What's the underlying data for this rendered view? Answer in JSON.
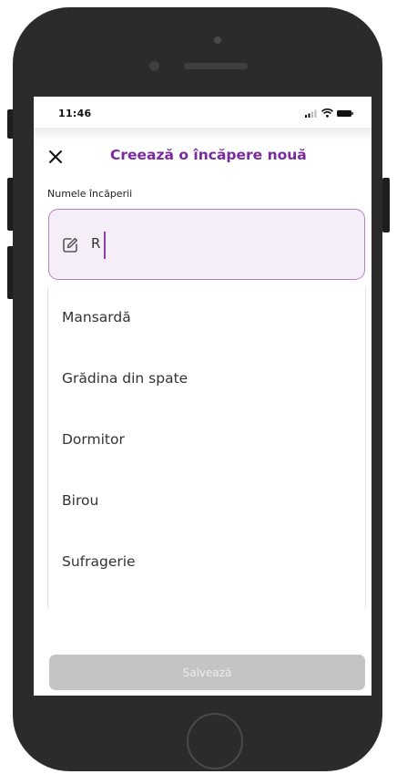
{
  "status_bar": {
    "time": "11:46"
  },
  "header": {
    "close_icon": "close-icon",
    "title": "Creează o încăpere nouă"
  },
  "form": {
    "label": "Numele încăperii",
    "input_value": "R",
    "input_icon": "edit-icon"
  },
  "suggestions": [
    {
      "label": "Mansardă"
    },
    {
      "label": "Grădina din spate"
    },
    {
      "label": "Dormitor"
    },
    {
      "label": "Birou"
    },
    {
      "label": "Sufragerie"
    }
  ],
  "save_button": {
    "label": "Salvează"
  },
  "colors": {
    "accent": "#7b2a9e",
    "input_border": "#b07fc4",
    "input_background": "#f5eef8",
    "disabled_button": "#c4c4c4"
  }
}
